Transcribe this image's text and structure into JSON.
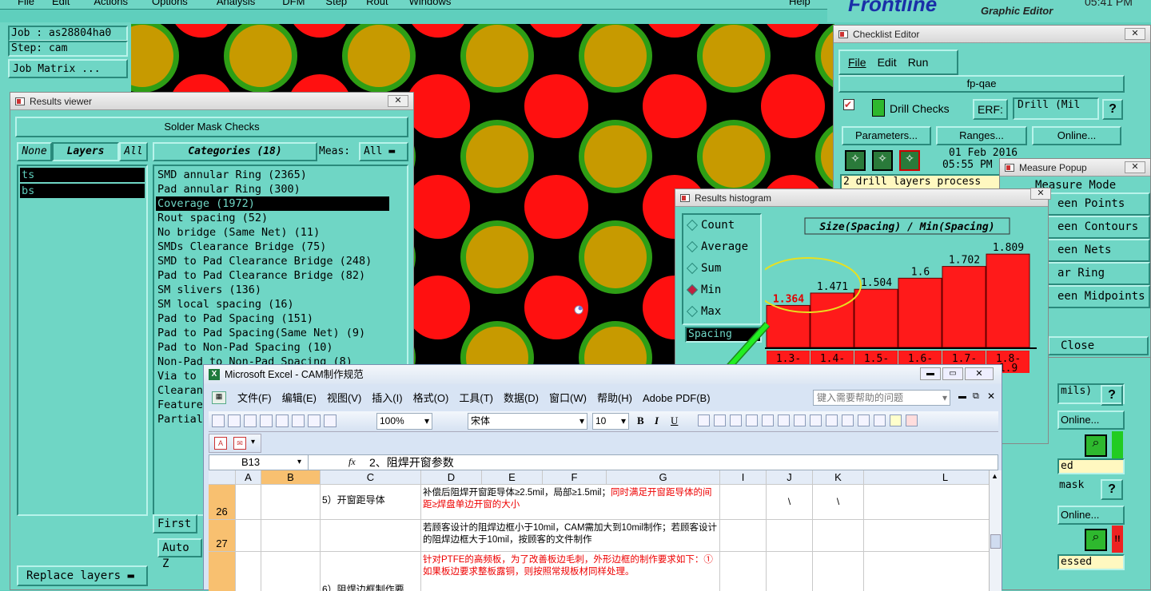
{
  "main_menu": [
    "File",
    "Edit",
    "Actions",
    "Options",
    "Analysis",
    "DFM",
    "Step",
    "Rout",
    "Windows"
  ],
  "help_label": "Help",
  "brand": "Frontline",
  "graphic_editor": "Graphic Editor",
  "clock": "05:41 PM",
  "job_label": "Job : as28804ha0",
  "step_label": "Step: cam",
  "job_matrix": "Job Matrix ...",
  "results_viewer": {
    "title": "Results viewer",
    "header": "Solder Mask Checks",
    "none_btn": "None",
    "layers_label": "Layers",
    "all_btn": "All",
    "categories_label": "Categories (18)",
    "meas_label": "Meas:",
    "meas_value": "All",
    "layers": [
      "ts",
      "bs"
    ],
    "categories": [
      "SMD annular Ring (2365)",
      "Pad annular Ring (300)",
      "Coverage (1972)",
      "Rout spacing (52)",
      "No bridge (Same Net) (11)",
      "SMDs Clearance Bridge (75)",
      "SMD to Pad Clearance Bridge (248)",
      "Pad to Pad Clearance Bridge (82)",
      "SM slivers (136)",
      "SM local spacing (16)",
      "Pad to Pad Spacing (151)",
      "Pad to Pad Spacing(Same Net) (9)",
      "Pad to Non-Pad Spacing (10)",
      "Non-Pad to Non-Pad Spacing (8)",
      "Via to",
      "Clearan",
      "Feature",
      "Partial"
    ],
    "first_btn": "First",
    "auto_btn": "Auto Z",
    "replace_layers": "Replace layers"
  },
  "checklist": {
    "title": "Checklist Editor",
    "menu": [
      "File",
      "Edit",
      "Run"
    ],
    "name": "fp-qae",
    "drill_checks": "Drill Checks",
    "erf_label": "ERF:",
    "erf_value": "Drill (Mil",
    "help_q": "?",
    "parameters": "Parameters...",
    "ranges": "Ranges...",
    "online": "Online...",
    "date": "01 Feb 2016",
    "time": "05:55 PM -",
    "status": "2 drill layers process",
    "side_rows": [
      "mils)",
      "Online...",
      "ed",
      "mask",
      "Online...",
      "essed"
    ],
    "bang": "!!"
  },
  "measure_popup": {
    "title": "Measure Popup",
    "items": [
      "Measure Mode",
      "een Points",
      "een Contours",
      "een Nets",
      "ar Ring",
      "een Midpoints"
    ],
    "close": "Close"
  },
  "histogram": {
    "title": "Results histogram",
    "options": [
      "Count",
      "Average",
      "Sum",
      "Min",
      "Max"
    ],
    "selected": "Min",
    "spacing_value": "Spacing",
    "chart_title": "Size(Spacing) / Min(Spacing)",
    "bins": [
      "1.3-",
      "1.4-",
      "1.5-",
      "1.6-",
      "1.7-",
      "1.8-"
    ],
    "bins_extra": "1.9"
  },
  "chart_data": {
    "type": "bar",
    "title": "Size(Spacing) / Min(Spacing)",
    "categories": [
      "1.3-",
      "1.4-",
      "1.5-",
      "1.6-",
      "1.7-",
      "1.8-"
    ],
    "values": [
      1.364,
      1.471,
      1.504,
      1.6,
      1.702,
      1.809
    ],
    "value_labels": [
      "1.364",
      "1.471",
      "1.504",
      "1.6",
      "1.702",
      "1.809"
    ],
    "ylim": [
      1.0,
      1.9
    ],
    "highlight_color": "#e00000",
    "bar_color": "#ff1a1a"
  },
  "excel": {
    "title": "Microsoft Excel - CAM制作规范",
    "menu": [
      "文件(F)",
      "编辑(E)",
      "视图(V)",
      "插入(I)",
      "格式(O)",
      "工具(T)",
      "数据(D)",
      "窗口(W)",
      "帮助(H)",
      "Adobe PDF(B)"
    ],
    "help_placeholder": "键入需要帮助的问题",
    "zoom": "100%",
    "font_name": "宋体",
    "font_size": "10",
    "namebox": "B13",
    "fx": "fx",
    "formula": "2、阻焊开窗参数",
    "columns": [
      "A",
      "B",
      "C",
      "D",
      "E",
      "F",
      "G",
      "I",
      "J",
      "K",
      "L"
    ],
    "rows": [
      {
        "num": "26",
        "c": "5）开窗距导体",
        "d_black": "补偿后阻焊开窗距导体≥2.5mil，局部≥1.5mil；",
        "d_red": "同时满足开窗距导体的间距≥焊盘单边开窗的大小",
        "j": "\\",
        "k": "\\"
      },
      {
        "num": "27",
        "c": "",
        "d_black": "若顾客设计的阻焊边框小于10mil，CAM需加大到10mil制作；若顾客设计的阻焊边框大于10mil，按顾客的文件制作",
        "d_red": "",
        "j": "",
        "k": ""
      },
      {
        "num": "",
        "c": "6）阻焊边框制作要",
        "d_black": "",
        "d_red": "针对PTFE的高频板，为了改善板边毛刺，外形边框的制作要求如下：①如果板边要求整板露铜，则按照常规板材同样处理。",
        "j": "",
        "k": ""
      }
    ]
  },
  "colors": {
    "teal": "#6fd6c5",
    "pad_gold": "#c79a00",
    "pad_ring": "#2e9e15",
    "pad_red": "#ff1010",
    "arrow": "#22dd22",
    "ellipse": "#e8e020"
  }
}
